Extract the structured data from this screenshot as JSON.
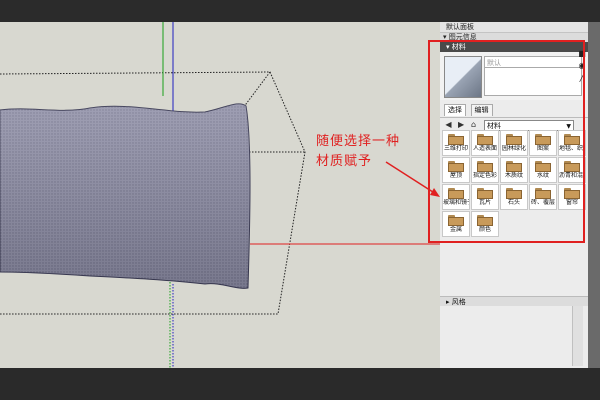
{
  "tray": {
    "title": "默认面板",
    "entity_info_header": "▾ 图元信息"
  },
  "materials": {
    "header": "▾ 材料",
    "name_placeholder": "默认",
    "tabs": [
      "选择",
      "编辑"
    ],
    "library_select": "材料",
    "items": [
      "三维打印",
      "人造表面",
      "园林绿化",
      "图案",
      "地毯、织物",
      "屋顶",
      "指定色彩",
      "木质纹",
      "水纹",
      "沥青和混凝土",
      "玻璃和镜子",
      "瓦片",
      "石头",
      "砖、覆层",
      "窗帘",
      "金属",
      "颜色"
    ]
  },
  "styles": {
    "header": "▸ 风格"
  },
  "annotation": {
    "lines": [
      "随便选择一种",
      "材质赋予"
    ]
  },
  "colors": {
    "annotation_red": "#e02020",
    "model": "#8c8ca0"
  },
  "icons": {
    "nav_back": "arrow-left-icon",
    "nav_forward": "arrow-right-icon",
    "home": "home-icon",
    "details": "details-icon"
  }
}
